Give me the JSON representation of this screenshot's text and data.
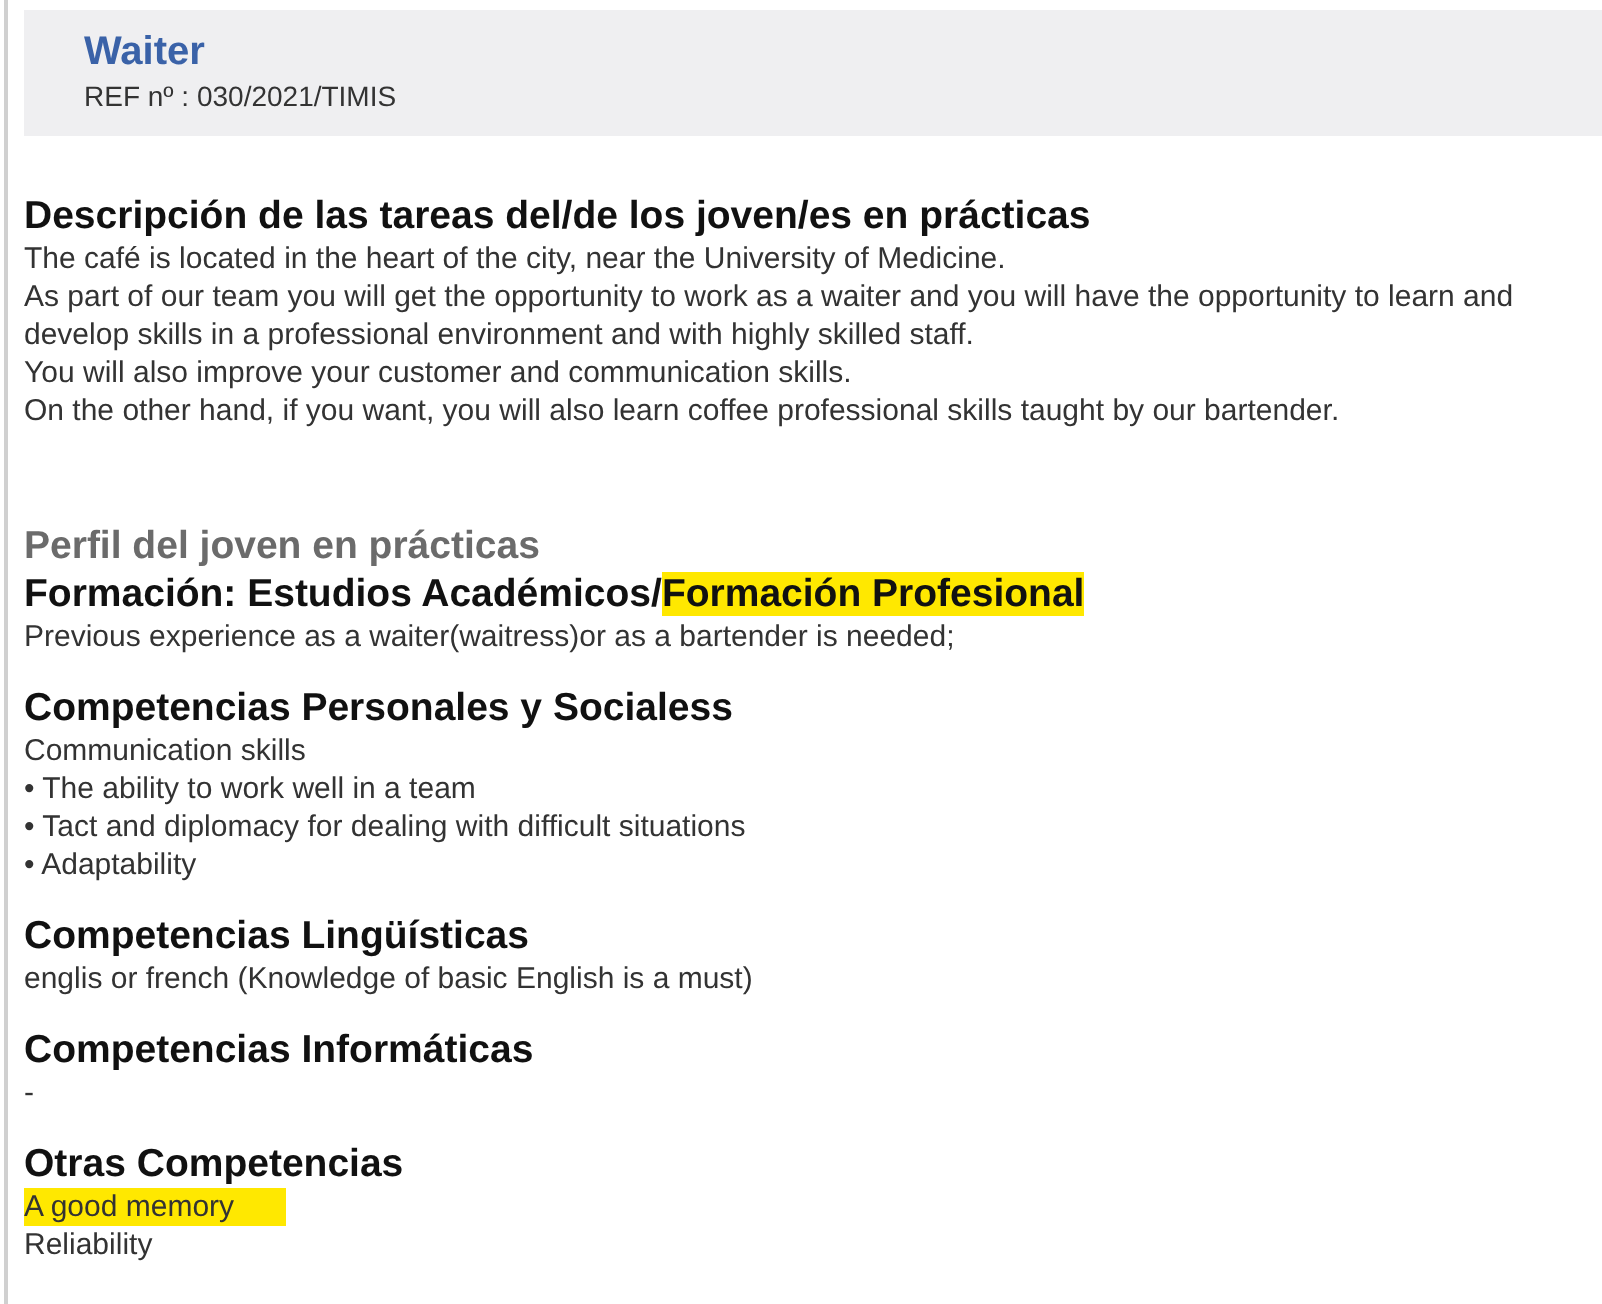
{
  "header": {
    "title": "Waiter",
    "reference": "REF nº : 030/2021/TIMIS"
  },
  "description": {
    "heading": "Descripción de las tareas del/de los joven/es en prácticas",
    "lines": [
      "The café is located in the heart of the city, near the University of Medicine.",
      "As part of our team you will get the opportunity to work as a waiter and you will have the opportunity to learn and develop skills in a professional environment and with highly skilled staff.",
      "You will also improve your customer and communication skills.",
      "On the other hand, if you want, you will also learn coffee professional skills taught by our bartender."
    ]
  },
  "profile": {
    "heading": "Perfil del joven en prácticas",
    "sections": [
      {
        "heading_parts": [
          {
            "text": "Formación: Estudios Académicos/",
            "highlighted": false
          },
          {
            "text": "Formación Profesional",
            "highlighted": true
          }
        ],
        "lines": [
          {
            "text": "Previous experience as a waiter(waitress)or as a bartender is needed;",
            "highlighted": false
          }
        ]
      },
      {
        "heading_parts": [
          {
            "text": "Competencias Personales y Socialess",
            "highlighted": false
          }
        ],
        "lines": [
          {
            "text": "Communication skills",
            "highlighted": false
          },
          {
            "text": "• The ability to work well in a team",
            "highlighted": false
          },
          {
            "text": "• Tact and diplomacy for dealing with difficult situations",
            "highlighted": false
          },
          {
            "text": "• Adaptability",
            "highlighted": false
          }
        ]
      },
      {
        "heading_parts": [
          {
            "text": "Competencias Lingüísticas",
            "highlighted": false
          }
        ],
        "lines": [
          {
            "text": "englis or french (Knowledge of basic English is a must)",
            "highlighted": false
          }
        ]
      },
      {
        "heading_parts": [
          {
            "text": "Competencias Informáticas",
            "highlighted": false
          }
        ],
        "lines": [
          {
            "text": "-",
            "highlighted": false
          }
        ]
      },
      {
        "heading_parts": [
          {
            "text": "Otras Competencias",
            "highlighted": false
          }
        ],
        "lines": [
          {
            "text": "A good memory",
            "highlighted": true
          },
          {
            "text": "Reliability",
            "highlighted": false
          }
        ]
      }
    ]
  }
}
